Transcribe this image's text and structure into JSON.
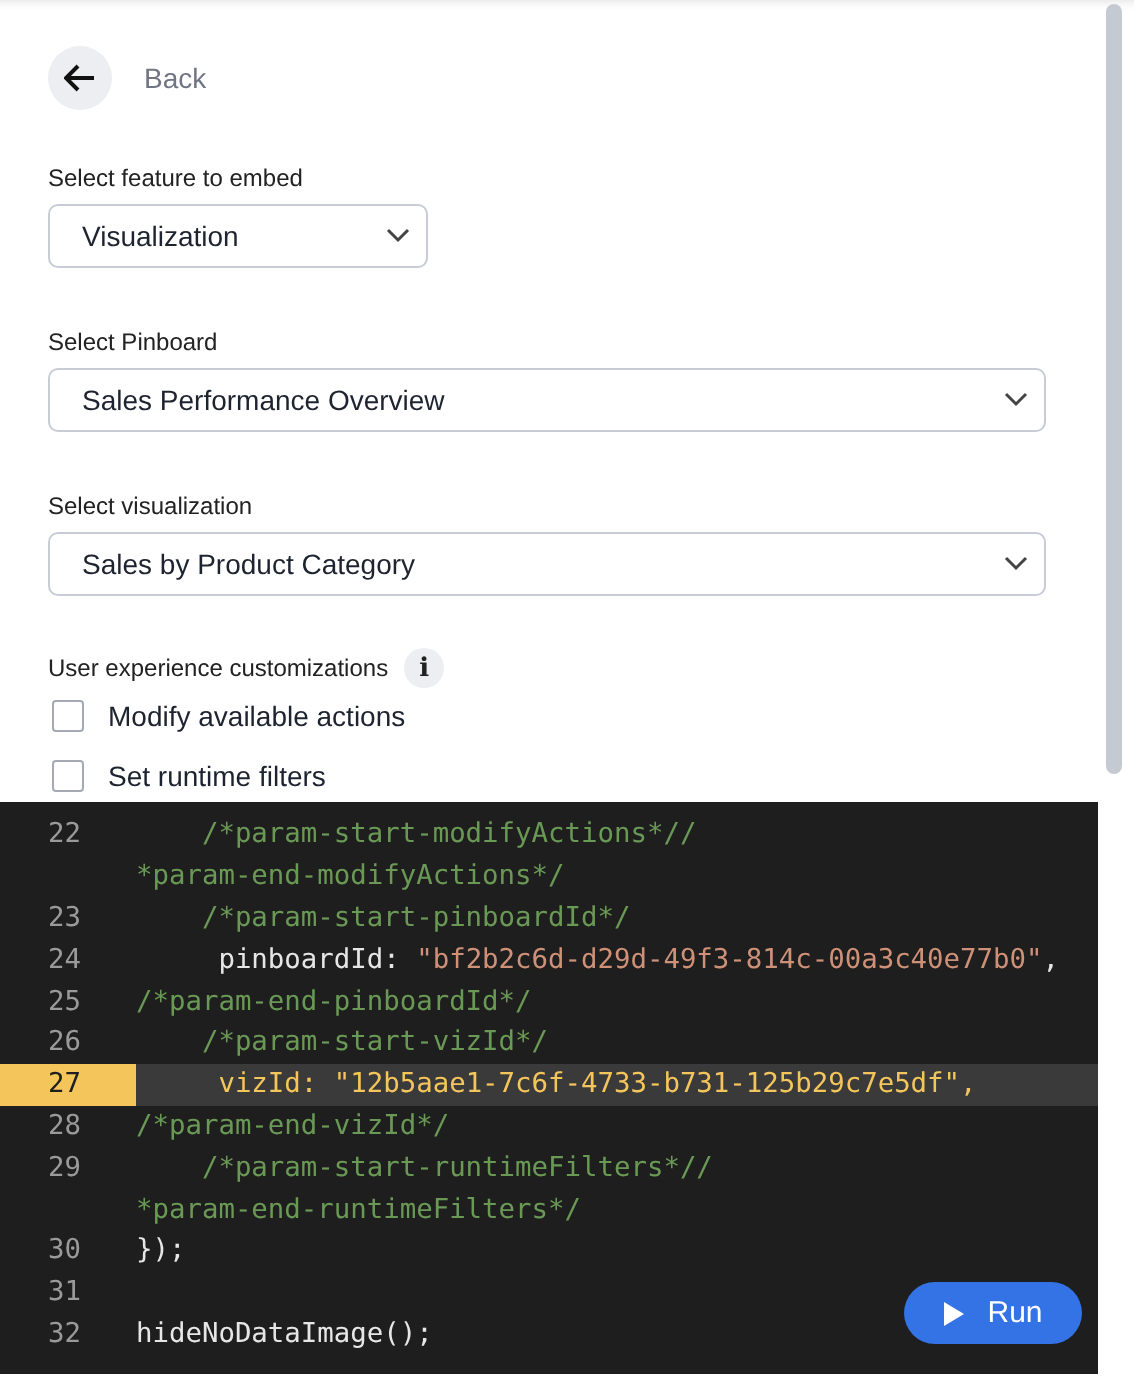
{
  "back": {
    "label": "Back"
  },
  "fields": [
    {
      "label": "Select feature to embed",
      "value": "Visualization",
      "wide": false
    },
    {
      "label": "Select Pinboard",
      "value": "Sales Performance Overview",
      "wide": true
    },
    {
      "label": "Select visualization",
      "value": "Sales by Product Category",
      "wide": true
    }
  ],
  "customizations": {
    "label": "User experience customizations",
    "info": "i",
    "options": [
      {
        "label": "Modify available actions",
        "checked": false
      },
      {
        "label": "Set runtime filters",
        "checked": false
      }
    ]
  },
  "code": {
    "lines": [
      {
        "number": "22",
        "active": false,
        "segments": [
          {
            "kind": "comment",
            "text": "    /*param-start-modifyActions*//"
          }
        ]
      },
      {
        "active": false,
        "segments": [
          {
            "kind": "comment",
            "text": "*param-end-modifyActions*/"
          }
        ]
      },
      {
        "number": "23",
        "active": false,
        "segments": [
          {
            "kind": "comment",
            "text": "    /*param-start-pinboardId*/"
          }
        ]
      },
      {
        "number": "24",
        "active": false,
        "segments": [
          {
            "kind": "plain",
            "text": "     pinboardId: "
          },
          {
            "kind": "string",
            "text": "\"bf2b2c6d-d29d-49f3-814c-00a3c40e77b0\""
          },
          {
            "kind": "plain",
            "text": ","
          }
        ]
      },
      {
        "number": "25",
        "active": false,
        "segments": [
          {
            "kind": "comment",
            "text": "/*param-end-pinboardId*/"
          }
        ]
      },
      {
        "number": "26",
        "active": false,
        "segments": [
          {
            "kind": "comment",
            "text": "    /*param-start-vizId*/"
          }
        ]
      },
      {
        "number": "27",
        "active": true,
        "segments": [
          {
            "kind": "plain",
            "text": "     vizId: "
          },
          {
            "kind": "string",
            "text": "\"12b5aae1-7c6f-4733-b731-125b29c7e5df\""
          },
          {
            "kind": "plain",
            "text": ","
          }
        ]
      },
      {
        "number": "28",
        "active": false,
        "segments": [
          {
            "kind": "comment",
            "text": "/*param-end-vizId*/"
          }
        ]
      },
      {
        "number": "29",
        "active": false,
        "segments": [
          {
            "kind": "comment",
            "text": "    /*param-start-runtimeFilters*//"
          }
        ]
      },
      {
        "active": false,
        "segments": [
          {
            "kind": "comment",
            "text": "*param-end-runtimeFilters*/"
          }
        ]
      },
      {
        "number": "30",
        "active": false,
        "segments": [
          {
            "kind": "plain",
            "text": "});"
          }
        ]
      },
      {
        "number": "31",
        "active": false
      },
      {
        "number": "32",
        "active": false,
        "segments": [
          {
            "kind": "plain",
            "text": "hideNoDataImage();"
          }
        ]
      }
    ],
    "run": "Run"
  }
}
